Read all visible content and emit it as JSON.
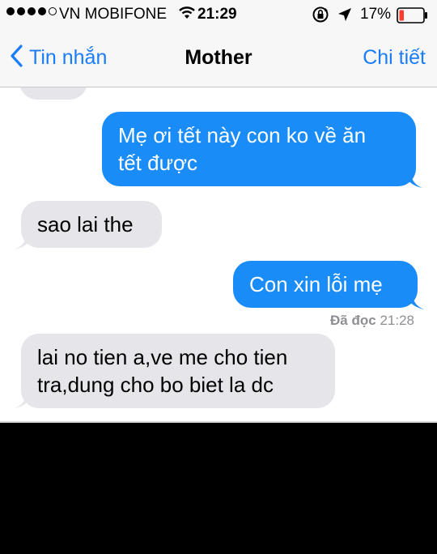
{
  "status_bar": {
    "carrier": "VN MOBIFONE",
    "time": "21:29",
    "battery": "17%"
  },
  "nav": {
    "back_label": "Tin nhắn",
    "title": "Mother",
    "details_label": "Chi tiết"
  },
  "messages": [
    {
      "direction": "sent",
      "text": "Mẹ ơi tết này con ko về ăn tết được",
      "line1": "Mẹ ơi tết này con ko về ăn",
      "line2": "tết được"
    },
    {
      "direction": "received",
      "text": "sao lai the"
    },
    {
      "direction": "sent",
      "text": "Con xin lỗi mẹ"
    },
    {
      "direction": "received",
      "text": "lai no tien a,ve me cho tien tra,dung cho bo biet la dc",
      "line1": "lai no tien a,ve me cho tien",
      "line2": "tra,dung cho bo biet la dc"
    }
  ],
  "read_receipt": {
    "label": "Đã đọc",
    "time": "21:28"
  },
  "colors": {
    "sent_bubble": "#1a8cf7",
    "received_bubble": "#e5e5ea",
    "accent": "#1a7cf6"
  },
  "icons": [
    "signal-dots-icon",
    "wifi-icon",
    "rotation-lock-icon",
    "location-arrow-icon",
    "battery-icon",
    "chevron-left-icon"
  ]
}
